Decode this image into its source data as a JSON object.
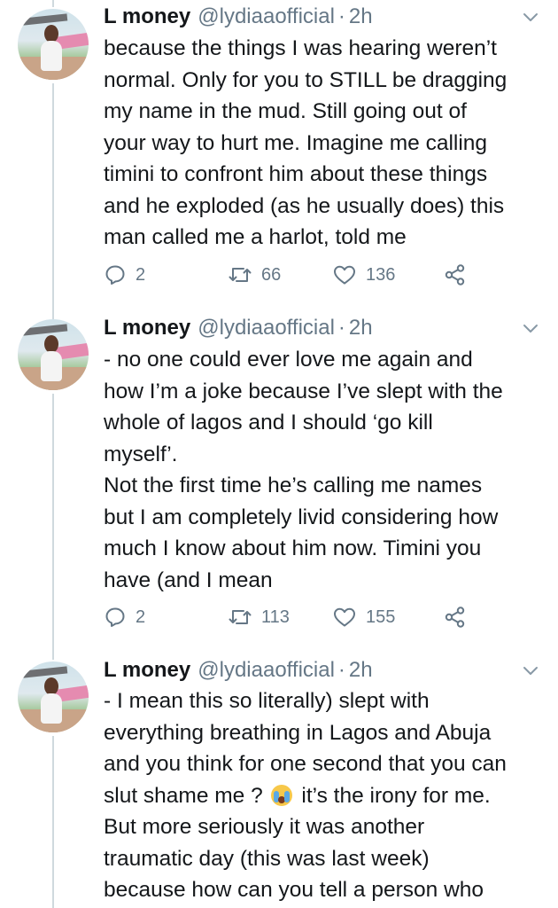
{
  "tweets": [
    {
      "author": {
        "name": "L money",
        "handle": "@lydiaaofficial"
      },
      "separator": "·",
      "time": "2h",
      "lines": [
        "because the things I was hearing weren’t",
        "normal. Only for you to STILL be dragging",
        "my name in the mud. Still going out of",
        "your way to hurt me. Imagine me calling",
        "timini to confront him about these things",
        "and he exploded (as he usually does) this",
        "man called me a harlot, told me"
      ],
      "stats": {
        "replies": "2",
        "retweets": "66",
        "likes": "136"
      }
    },
    {
      "author": {
        "name": "L money",
        "handle": "@lydiaaofficial"
      },
      "separator": "·",
      "time": "2h",
      "lines": [
        "- no one could ever love me again and",
        "how I’m a joke because I’ve slept with the",
        "whole of lagos and I should ‘go kill",
        "myself’.",
        "Not the first time he’s calling me names",
        "but I am completely livid considering how",
        "much I know about him now. Timini you",
        "have (and I mean"
      ],
      "stats": {
        "replies": "2",
        "retweets": "113",
        "likes": "155"
      }
    },
    {
      "author": {
        "name": "L money",
        "handle": "@lydiaaofficial"
      },
      "separator": "·",
      "time": "2h",
      "lines": [
        "- I mean this so literally) slept with",
        "everything breathing in Lagos and Abuja",
        "and you think for one second that you can",
        "slut shame me ?",
        "But more seriously it was another",
        "traumatic day (this was last week)",
        "because how can you tell a person who"
      ],
      "line4_suffix": "it’s the irony for me.",
      "emoji": "loudly-crying-face-icon"
    }
  ],
  "colors": {
    "text": "#14171a",
    "muted": "#657786",
    "thread_line": "#cfd9de"
  }
}
